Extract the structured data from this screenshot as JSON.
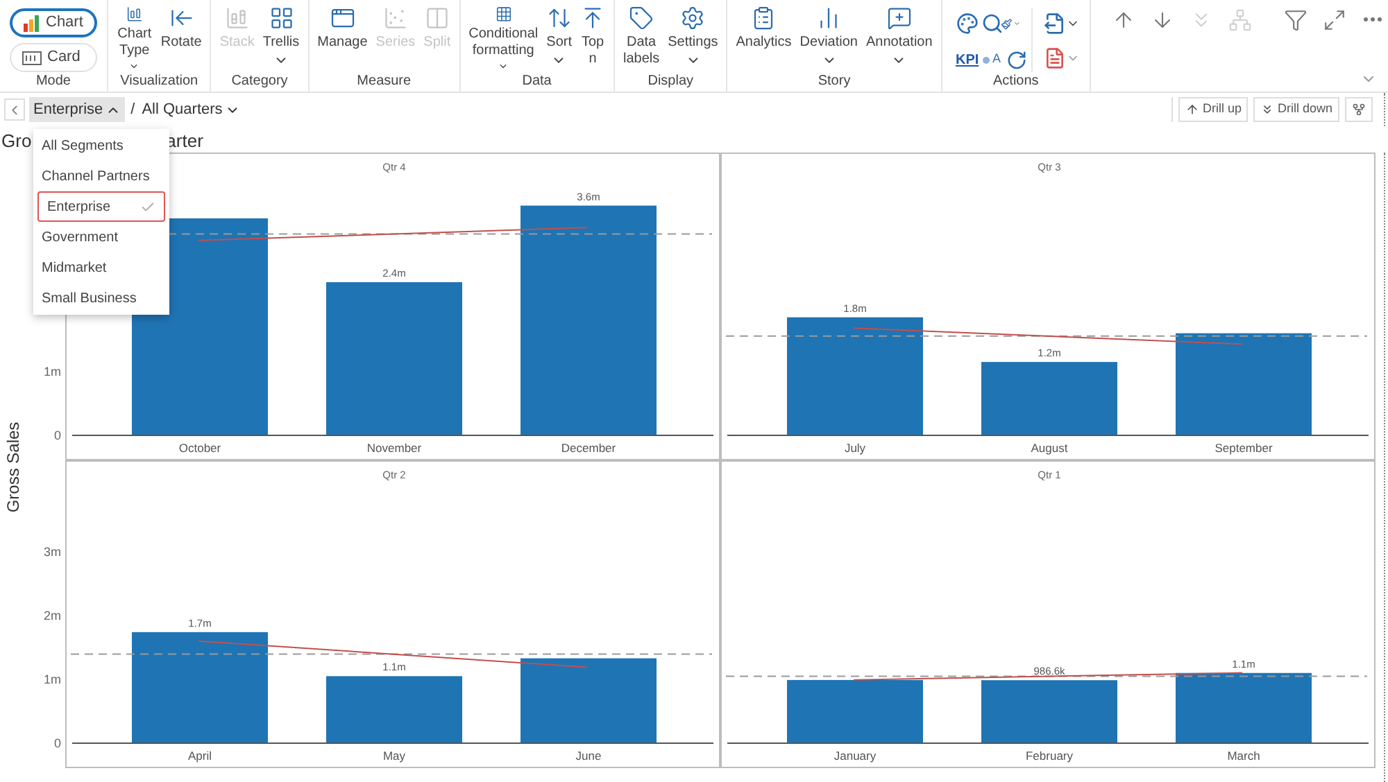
{
  "ribbon": {
    "groups": [
      {
        "label": "Mode",
        "kind": "mode",
        "items": [
          {
            "label": "Chart",
            "selected": true
          },
          {
            "label": "Card",
            "selected": false
          }
        ]
      },
      {
        "label": "Visualization",
        "kind": "buttons",
        "items": [
          {
            "label": "Chart Type",
            "disabled": false,
            "dropdown": true
          },
          {
            "label": "Rotate",
            "disabled": false,
            "dropdown": false
          }
        ]
      },
      {
        "label": "Category",
        "kind": "buttons",
        "items": [
          {
            "label": "Stack",
            "disabled": true,
            "dropdown": false
          },
          {
            "label": "Trellis",
            "disabled": false,
            "dropdown": true
          }
        ]
      },
      {
        "label": "Measure",
        "kind": "buttons",
        "items": [
          {
            "label": "Manage",
            "disabled": false,
            "dropdown": false
          },
          {
            "label": "Series",
            "disabled": true,
            "dropdown": false
          },
          {
            "label": "Split",
            "disabled": true,
            "dropdown": false
          }
        ]
      },
      {
        "label": "Data",
        "kind": "buttons",
        "items": [
          {
            "label": "Conditional formatting",
            "disabled": false,
            "dropdown": true
          },
          {
            "label": "Sort",
            "disabled": false,
            "dropdown": true
          },
          {
            "label": "Top n",
            "disabled": false,
            "dropdown": false
          }
        ]
      },
      {
        "label": "Display",
        "kind": "buttons",
        "items": [
          {
            "label": "Data labels",
            "disabled": false,
            "dropdown": false
          },
          {
            "label": "Settings",
            "disabled": false,
            "dropdown": true
          }
        ]
      },
      {
        "label": "Story",
        "kind": "buttons",
        "items": [
          {
            "label": "Analytics",
            "disabled": false,
            "dropdown": false
          },
          {
            "label": "Deviation",
            "disabled": false,
            "dropdown": true
          },
          {
            "label": "Annotation",
            "disabled": false,
            "dropdown": true
          }
        ]
      },
      {
        "label": "Actions",
        "kind": "actions",
        "items": [
          {
            "label": "KPI"
          },
          {
            "label": "A"
          }
        ]
      }
    ]
  },
  "toolbar": [
    {
      "disabled": false
    },
    {
      "disabled": false
    },
    {
      "disabled": true
    },
    {
      "disabled": true
    },
    {
      "disabled": false
    },
    {
      "disabled": false
    },
    {
      "disabled": false
    }
  ],
  "breadcrumb": {
    "segment": {
      "label": "Enterprise",
      "expanded": true
    },
    "separator": "/",
    "period": {
      "label": "All Quarters",
      "expanded": false
    }
  },
  "drill": {
    "buttons": [
      "Drill up",
      "Drill down"
    ]
  },
  "title_parts": [
    "Gro",
    "arter"
  ],
  "segment_menu": [
    {
      "label": "All Segments",
      "selected": false
    },
    {
      "label": "Channel Partners",
      "selected": false
    },
    {
      "label": "Enterprise",
      "selected": true
    },
    {
      "label": "Government",
      "selected": false
    },
    {
      "label": "Midmarket",
      "selected": false
    },
    {
      "label": "Small Business",
      "selected": false
    }
  ],
  "trellis": {
    "ylabel": "Gross Sales",
    "panels": [
      {
        "chart_data": {
          "type": "bar",
          "title": "Qtr 4",
          "categories": [
            "October",
            "November",
            "December"
          ],
          "values": [
            3400000,
            2400000,
            3600000
          ],
          "ylim": [
            0,
            4410000
          ],
          "yticks": [
            {
              "value": 0,
              "label": "0"
            },
            {
              "value": 1000000,
              "label": "1m"
            }
          ],
          "value_labels": [
            null,
            "2.4m",
            "3.6m"
          ]
        }
      },
      {
        "chart_data": {
          "type": "bar",
          "title": "Qtr 3",
          "categories": [
            "July",
            "August",
            "September"
          ],
          "values": [
            1850000,
            1150000,
            1600000
          ],
          "ylim": [
            0,
            4410000
          ],
          "value_labels": [
            "1.8m",
            "1.2m",
            null
          ]
        }
      },
      {
        "chart_data": {
          "type": "bar",
          "title": "Qtr 2",
          "categories": [
            "April",
            "May",
            "June"
          ],
          "values": [
            1740000,
            1050000,
            1330000
          ],
          "ylim": [
            0,
            4410000
          ],
          "yticks": [
            {
              "value": 0,
              "label": "0"
            },
            {
              "value": 1000000,
              "label": "1m"
            },
            {
              "value": 2000000,
              "label": "2m"
            },
            {
              "value": 3000000,
              "label": "3m"
            }
          ],
          "value_labels": [
            "1.7m",
            "1.1m",
            null
          ]
        }
      },
      {
        "chart_data": {
          "type": "bar",
          "title": "Qtr 1",
          "categories": [
            "January",
            "February",
            "March"
          ],
          "values": [
            990000,
            986600,
            1100000
          ],
          "ylim": [
            0,
            4410000
          ],
          "value_labels": [
            null,
            "986.6k",
            "1.1m"
          ]
        }
      }
    ]
  }
}
